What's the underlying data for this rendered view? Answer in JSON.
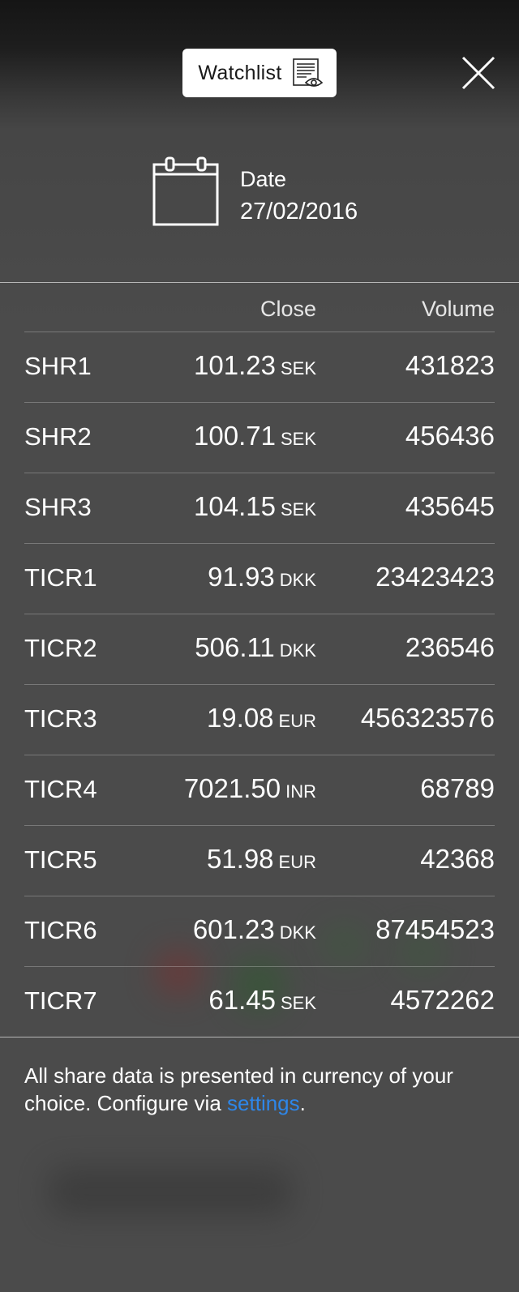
{
  "header": {
    "watchlist_label": "Watchlist",
    "watchlist_icon": "watchlist-eye-icon",
    "close_icon": "close-icon"
  },
  "date": {
    "label": "Date",
    "value": "27/02/2016",
    "icon": "calendar-icon"
  },
  "table": {
    "columns": {
      "close": "Close",
      "volume": "Volume"
    },
    "rows": [
      {
        "symbol": "SHR1",
        "close": "101.23",
        "currency": "SEK",
        "volume": "431823"
      },
      {
        "symbol": "SHR2",
        "close": "100.71",
        "currency": "SEK",
        "volume": "456436"
      },
      {
        "symbol": "SHR3",
        "close": "104.15",
        "currency": "SEK",
        "volume": "435645"
      },
      {
        "symbol": "TICR1",
        "close": "91.93",
        "currency": "DKK",
        "volume": "23423423"
      },
      {
        "symbol": "TICR2",
        "close": "506.11",
        "currency": "DKK",
        "volume": "236546"
      },
      {
        "symbol": "TICR3",
        "close": "19.08",
        "currency": "EUR",
        "volume": "456323576"
      },
      {
        "symbol": "TICR4",
        "close": "7021.50",
        "currency": "INR",
        "volume": "68789"
      },
      {
        "symbol": "TICR5",
        "close": "51.98",
        "currency": "EUR",
        "volume": "42368"
      },
      {
        "symbol": "TICR6",
        "close": "601.23",
        "currency": "DKK",
        "volume": "87454523"
      },
      {
        "symbol": "TICR7",
        "close": "61.45",
        "currency": "SEK",
        "volume": "4572262"
      }
    ]
  },
  "footer": {
    "text_before": "All share data is presented in currency of your choice. Configure via ",
    "link_label": "settings",
    "text_after": "."
  },
  "colors": {
    "link": "#2e86e8",
    "overlay": "#4b4b4b",
    "button_bg": "#ffffff"
  }
}
